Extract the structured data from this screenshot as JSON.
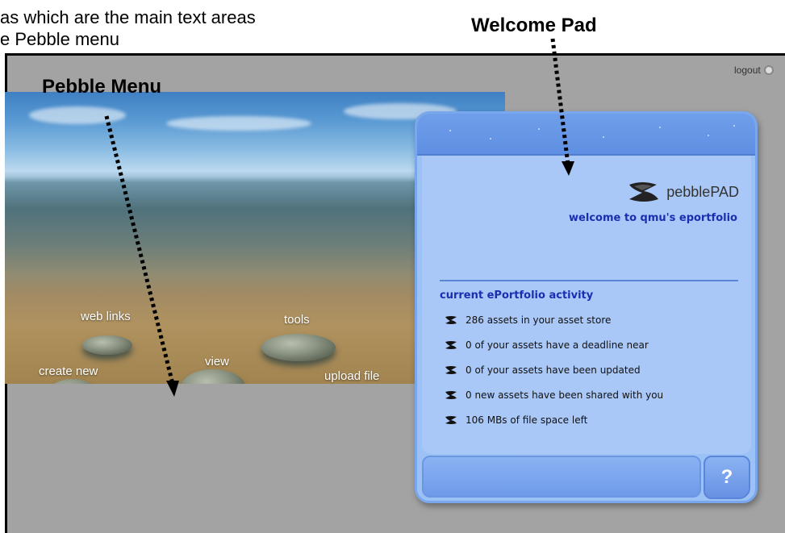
{
  "annotation": {
    "top_line1": "as which are the main text areas",
    "top_line2": "e Pebble menu",
    "welcome_pad_label": "Welcome Pad",
    "pebble_menu_label": "Pebble Menu"
  },
  "header": {
    "logout_label": "logout"
  },
  "pebbles": {
    "web_links": "web links",
    "tools": "tools",
    "create_new": "create new",
    "view": "view",
    "upload_file": "upload file"
  },
  "pad": {
    "logo_pebble": "pebble",
    "logo_pad": "PAD",
    "welcome": "welcome to qmu's eportfolio",
    "activity_title": "current ePortfolio activity",
    "activity": [
      "286 assets in your asset store",
      "0 of your assets have a deadline near",
      "0 of your assets have been updated",
      "0 new assets have been shared with you",
      "106 MBs of file space left"
    ],
    "help_label": "?"
  },
  "colors": {
    "pad_blue": "#9cc1f5",
    "title_blue": "#1a2fb0",
    "background_grey": "#a3a3a3"
  }
}
